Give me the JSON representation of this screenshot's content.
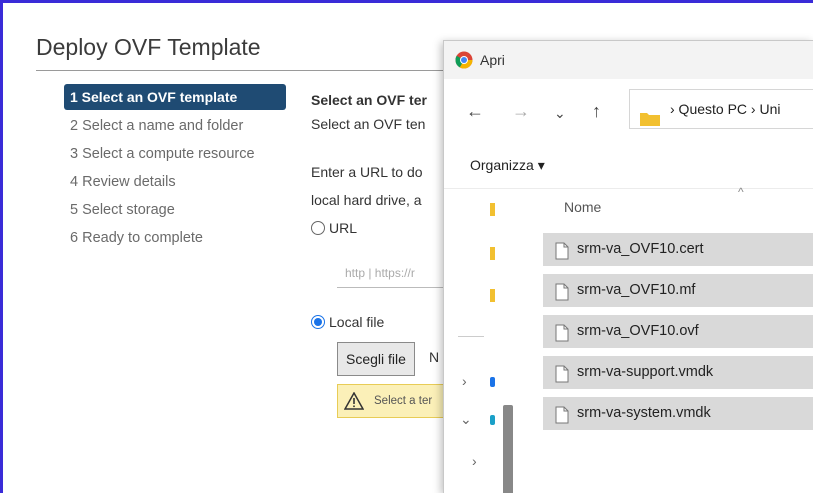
{
  "wizard": {
    "title": "Deploy OVF Template",
    "steps": [
      "1 Select an OVF template",
      "2 Select a name and folder",
      "3 Select a compute resource",
      "4 Review details",
      "5 Select storage",
      "6 Ready to complete"
    ],
    "content": {
      "heading": "Select an OVF ter",
      "subheading": "Select an OVF ten",
      "desc_line1": "Enter a URL to do",
      "desc_line2": "local hard drive, a",
      "url_label": "URL",
      "url_placeholder": "http | https://r",
      "local_file_label": "Local file",
      "choose_file_button": "Scegli file",
      "no_file_text": "N",
      "warning_text": "Select a ter"
    }
  },
  "dialog": {
    "title": "Apri",
    "path": "› Questo PC › Uni",
    "organize_label": "Organizza ▾",
    "column_name": "Nome",
    "files": [
      "srm-va_OVF10.cert",
      "srm-va_OVF10.mf",
      "srm-va_OVF10.ovf",
      "srm-va-support.vmdk",
      "srm-va-system.vmdk"
    ]
  },
  "colors": {
    "active_step_bg": "#1f4b73",
    "radio_accent": "#1a73e8",
    "selected_file_bg": "#d9d9d9",
    "warning_bg": "#fbf0b8",
    "frame_border": "#3a2bd8"
  }
}
